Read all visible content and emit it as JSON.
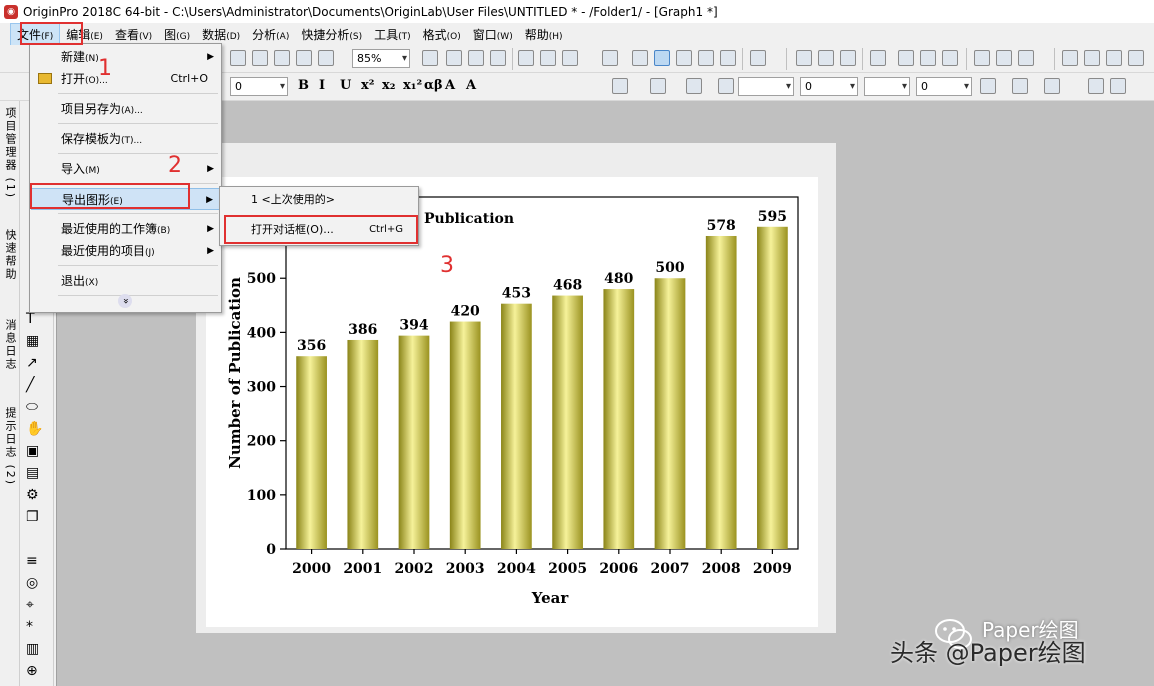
{
  "window": {
    "title": "OriginPro 2018C 64-bit - C:\\Users\\Administrator\\Documents\\OriginLab\\User Files\\UNTITLED * - /Folder1/ - [Graph1 *]"
  },
  "menubar": [
    {
      "label": "文件",
      "key": "(F)"
    },
    {
      "label": "编辑",
      "key": "(E)"
    },
    {
      "label": "查看",
      "key": "(V)"
    },
    {
      "label": "图",
      "key": "(G)"
    },
    {
      "label": "数据",
      "key": "(D)"
    },
    {
      "label": "分析",
      "key": "(A)"
    },
    {
      "label": "快捷分析",
      "key": "(S)"
    },
    {
      "label": "工具",
      "key": "(T)"
    },
    {
      "label": "格式",
      "key": "(O)"
    },
    {
      "label": "窗口",
      "key": "(W)"
    },
    {
      "label": "帮助",
      "key": "(H)"
    }
  ],
  "toolbar": {
    "zoom": "85%",
    "font_size": "0",
    "line_width": "0",
    "line_width2": "0"
  },
  "format_buttons": [
    "B",
    "I",
    "U",
    "x²",
    "x₂",
    "x₁²",
    "αβ",
    "A",
    "A"
  ],
  "dock_tabs": [
    "项目管理器 (1)",
    "快速帮助",
    "消息日志",
    "提示日志 (2)"
  ],
  "file_menu": {
    "items": [
      {
        "label": "新建",
        "key": "(N)",
        "shortcut": "",
        "submenu": true
      },
      {
        "label": "打开",
        "key": "(O)...",
        "shortcut": "Ctrl+O",
        "submenu": false
      },
      {
        "label": "项目另存为",
        "key": "(A)...",
        "shortcut": "",
        "submenu": false
      },
      {
        "label": "保存模板为",
        "key": "(T)...",
        "shortcut": "",
        "submenu": false
      },
      {
        "label": "导入",
        "key": "(M)",
        "shortcut": "",
        "submenu": true
      },
      {
        "label": "导出图形",
        "key": "(E)",
        "shortcut": "",
        "submenu": true
      },
      {
        "label": "最近使用的工作簿",
        "key": "(B)",
        "shortcut": "",
        "submenu": true
      },
      {
        "label": "最近使用的项目",
        "key": "(J)",
        "shortcut": "",
        "submenu": true
      },
      {
        "label": "退出",
        "key": "(X)",
        "shortcut": "",
        "submenu": false
      }
    ],
    "expand": "»"
  },
  "export_submenu": {
    "items": [
      {
        "label": "1 <上次使用的>",
        "shortcut": ""
      },
      {
        "label": "打开对话框(O)...",
        "shortcut": "Ctrl+G"
      }
    ]
  },
  "steps": [
    "1",
    "2",
    "3"
  ],
  "watermark": {
    "text1": "Paper绘图",
    "text2": "头条 @Paper绘图"
  },
  "chart_data": {
    "type": "bar",
    "title": "Publication",
    "xlabel": "Year",
    "ylabel": "Number of Publication",
    "categories": [
      "2000",
      "2001",
      "2002",
      "2003",
      "2004",
      "2005",
      "2006",
      "2007",
      "2008",
      "2009"
    ],
    "values": [
      356,
      386,
      394,
      420,
      453,
      468,
      480,
      500,
      578,
      595
    ],
    "ylim": [
      0,
      650
    ],
    "yticks": [
      0,
      100,
      200,
      300,
      400,
      500
    ],
    "bar_color": "#c8c040",
    "grid": false,
    "legend": "none"
  }
}
